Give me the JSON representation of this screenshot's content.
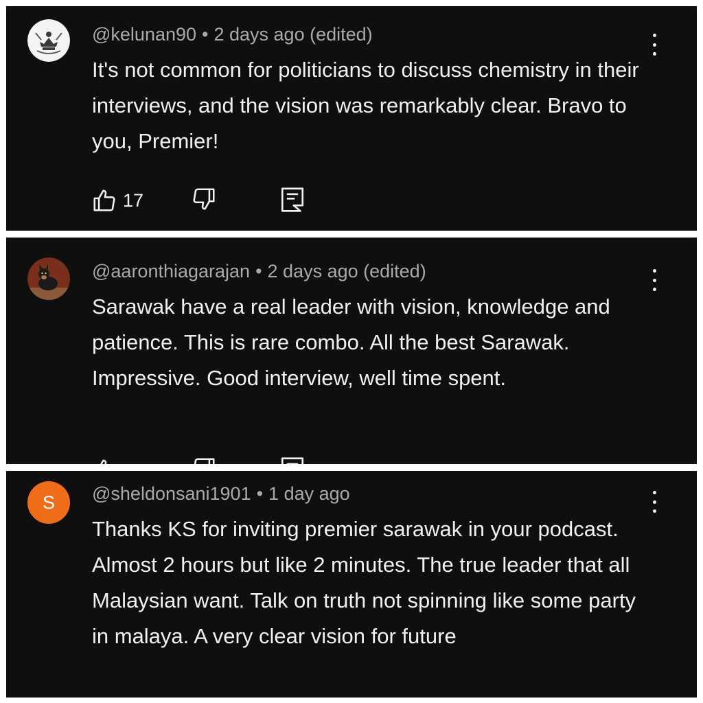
{
  "comments": [
    {
      "handle": "@kelunan90",
      "separator": "•",
      "time": "2 days ago (edited)",
      "text": "It's not common for politicians to discuss chemistry in their interviews, and the vision was remarkably clear. Bravo to you, Premier!",
      "likes": "17",
      "avatar_icon": "crest-icon"
    },
    {
      "handle": "@aaronthiagarajan",
      "separator": "•",
      "time": "2 days ago (edited)",
      "text": "Sarawak have a real leader  with vision, knowledge and patience. This is rare combo. All the best Sarawak. Impressive. Good interview, well time spent.",
      "avatar_icon": "dog-photo-icon"
    },
    {
      "handle": "@sheldonsani1901",
      "separator": "•",
      "time": "1 day ago",
      "text": "Thanks KS for inviting premier sarawak in your podcast. Almost 2 hours but like 2 minutes. The true leader that all Malaysian want. Talk on truth not spinning like some party in malaya. A very clear vision for future",
      "avatar_letter": "S",
      "avatar_color": "#ef6c19"
    }
  ],
  "colors": {
    "panel_background": "#0f0f0f",
    "text_primary": "#f1f1f1",
    "text_secondary": "#aaaaaa"
  }
}
